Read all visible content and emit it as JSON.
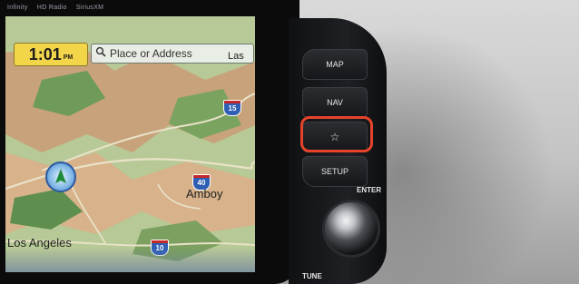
{
  "brand_strip": [
    "Infinity",
    "HD Radio",
    "SiriusXM"
  ],
  "nav": {
    "time": "1:01",
    "ampm": "PM",
    "search_placeholder": "Place or Address",
    "places": {
      "amboy": "Amboy",
      "los_angeles": "Los Angeles",
      "las": "Las"
    },
    "routes": {
      "i15": "15",
      "i40": "40",
      "i10": "10",
      "us95": ""
    }
  },
  "buttons": {
    "map": "MAP",
    "nav": "NAV",
    "favorite": "☆",
    "setup": "SETUP",
    "enter": "ENTER",
    "tune": "TUNE"
  },
  "colors": {
    "highlight": "#e5432a",
    "time_bg": "#f3d54a",
    "interstate": "#2f5fb4"
  }
}
